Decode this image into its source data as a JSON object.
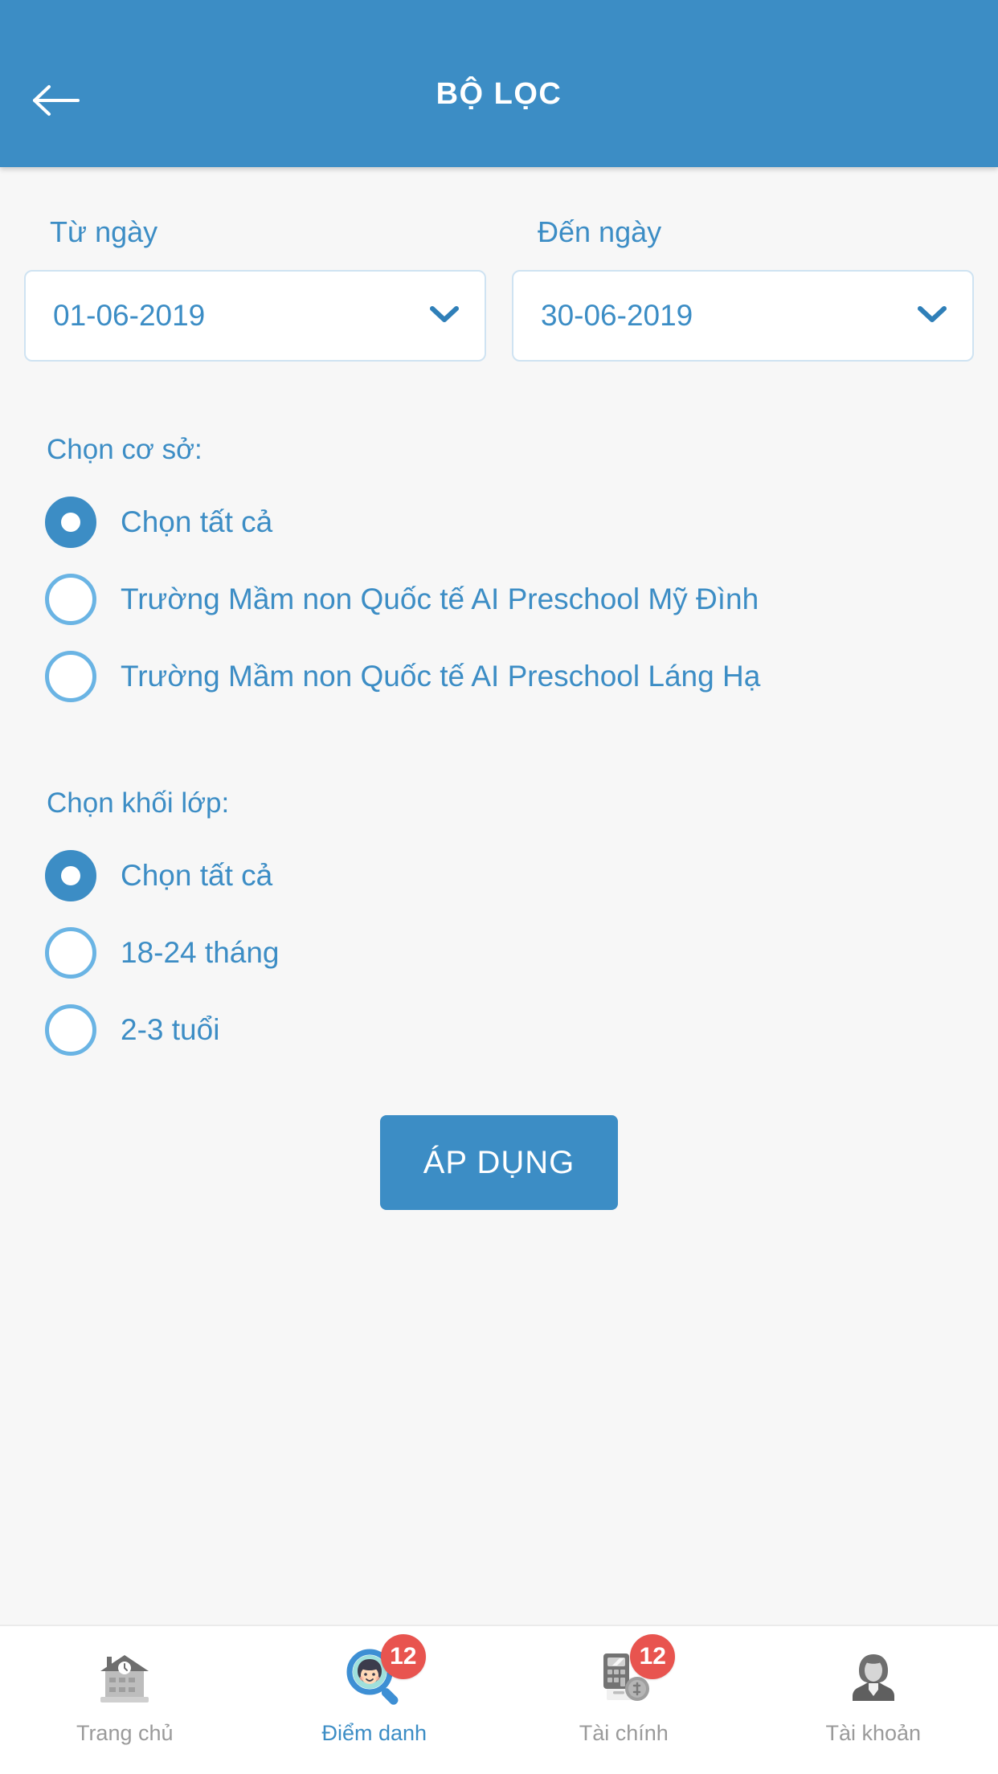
{
  "header": {
    "title": "BỘ LỌC",
    "back_icon": "arrow-left-icon",
    "background_color": "#3c8dc5"
  },
  "filters": {
    "date_from": {
      "label": "Từ ngày",
      "value": "01-06-2019",
      "dropdown_icon": "chevron-down-icon"
    },
    "date_to": {
      "label": "Đến ngày",
      "value": "30-06-2019",
      "dropdown_icon": "chevron-down-icon"
    },
    "site_group": {
      "title": "Chọn cơ sở:",
      "options": [
        {
          "label": "Chọn tất cả",
          "selected": true
        },
        {
          "label": "Trường Mầm non Quốc tế AI Preschool Mỹ Đình",
          "selected": false
        },
        {
          "label": "Trường Mầm non Quốc tế AI Preschool Láng Hạ",
          "selected": false
        }
      ]
    },
    "grade_group": {
      "title": "Chọn khối lớp:",
      "options": [
        {
          "label": "Chọn tất cả",
          "selected": true
        },
        {
          "label": "18-24 tháng",
          "selected": false
        },
        {
          "label": "2-3 tuổi",
          "selected": false
        }
      ]
    },
    "apply_button": {
      "label": "ÁP DỤNG",
      "color": "#3c8dc5"
    }
  },
  "tabbar": {
    "items": [
      {
        "label": "Trang chủ",
        "icon": "school-building-icon",
        "active": false,
        "badge": ""
      },
      {
        "label": "Điểm danh",
        "icon": "magnifier-child-icon",
        "active": true,
        "badge": "12"
      },
      {
        "label": "Tài chính",
        "icon": "calculator-coin-icon",
        "active": false,
        "badge": "12"
      },
      {
        "label": "Tài khoản",
        "icon": "person-avatar-icon",
        "active": false,
        "badge": ""
      }
    ],
    "badge_color": "#e8544f",
    "active_color": "#3c8dc5"
  }
}
